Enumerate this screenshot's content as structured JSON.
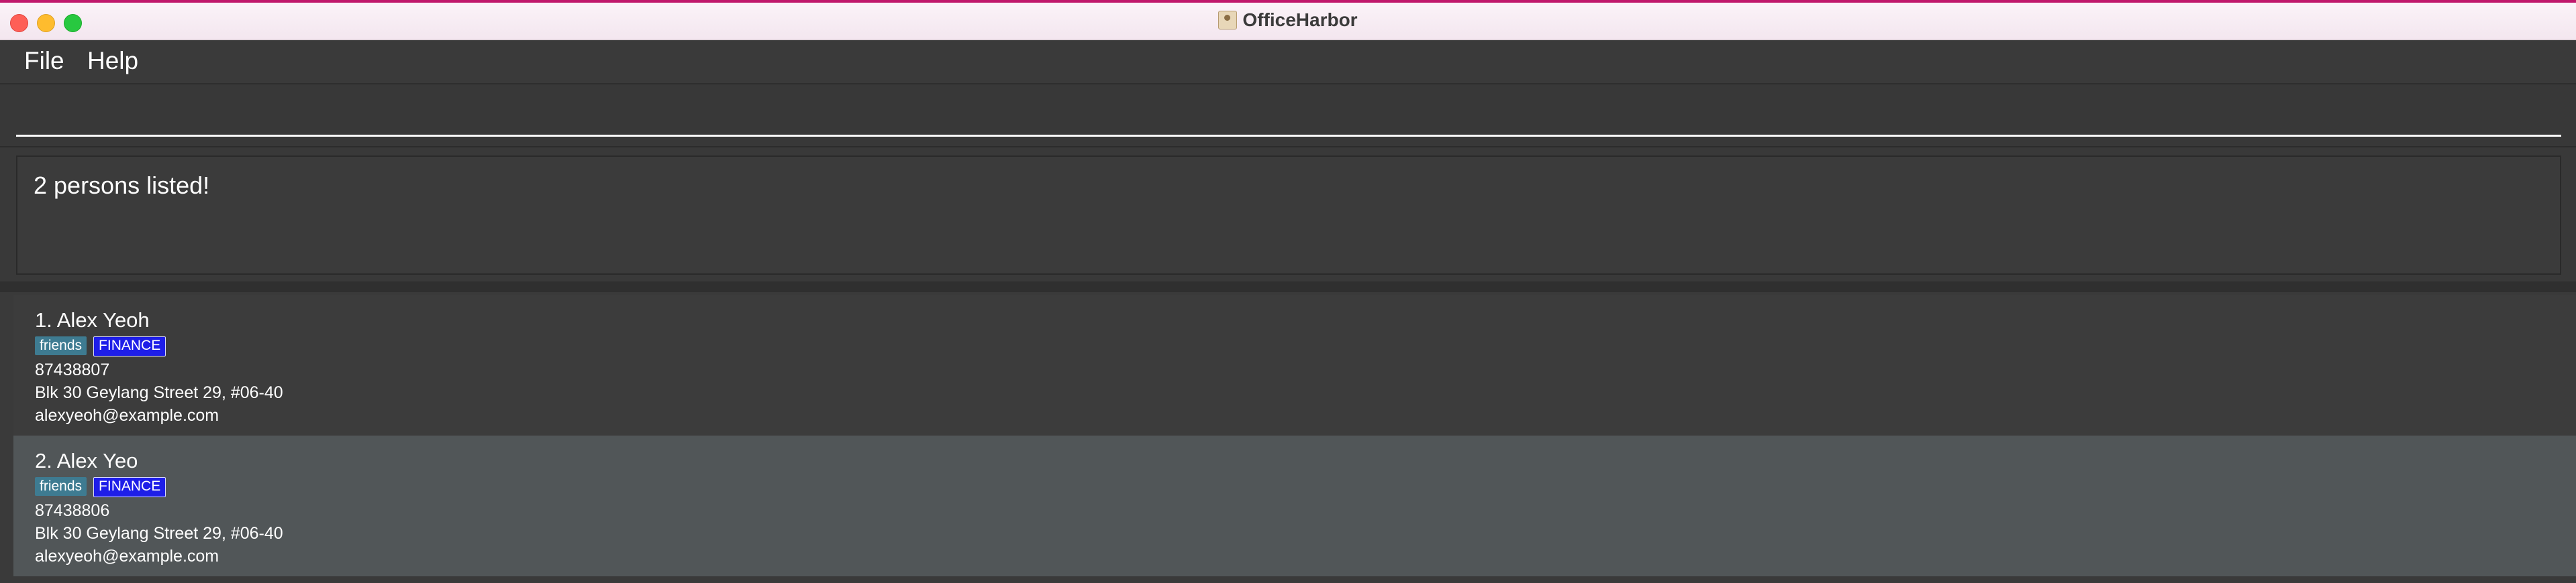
{
  "window": {
    "title": "OfficeHarbor",
    "title_icon": "address-book-icon"
  },
  "menu": {
    "file": "File",
    "help": "Help"
  },
  "command": {
    "value": "",
    "placeholder": ""
  },
  "result": {
    "message": "2 persons listed!"
  },
  "persons": [
    {
      "index_name": "1.  Alex Yeoh",
      "tags": [
        "friends",
        "FINANCE"
      ],
      "phone": "87438807",
      "address": "Blk 30 Geylang Street 29, #06-40",
      "email": "alexyeoh@example.com"
    },
    {
      "index_name": "2.  Alex Yeo",
      "tags": [
        "friends",
        "FINANCE"
      ],
      "phone": "87438806",
      "address": "Blk 30 Geylang Street 29, #06-40",
      "email": "alexyeoh@example.com"
    }
  ],
  "colors": {
    "background": "#3a3a3a",
    "selected_card": "#515658",
    "tag_friends": "#3e7b91",
    "tag_finance": "#1e1ee8",
    "text": "#ffffff"
  }
}
